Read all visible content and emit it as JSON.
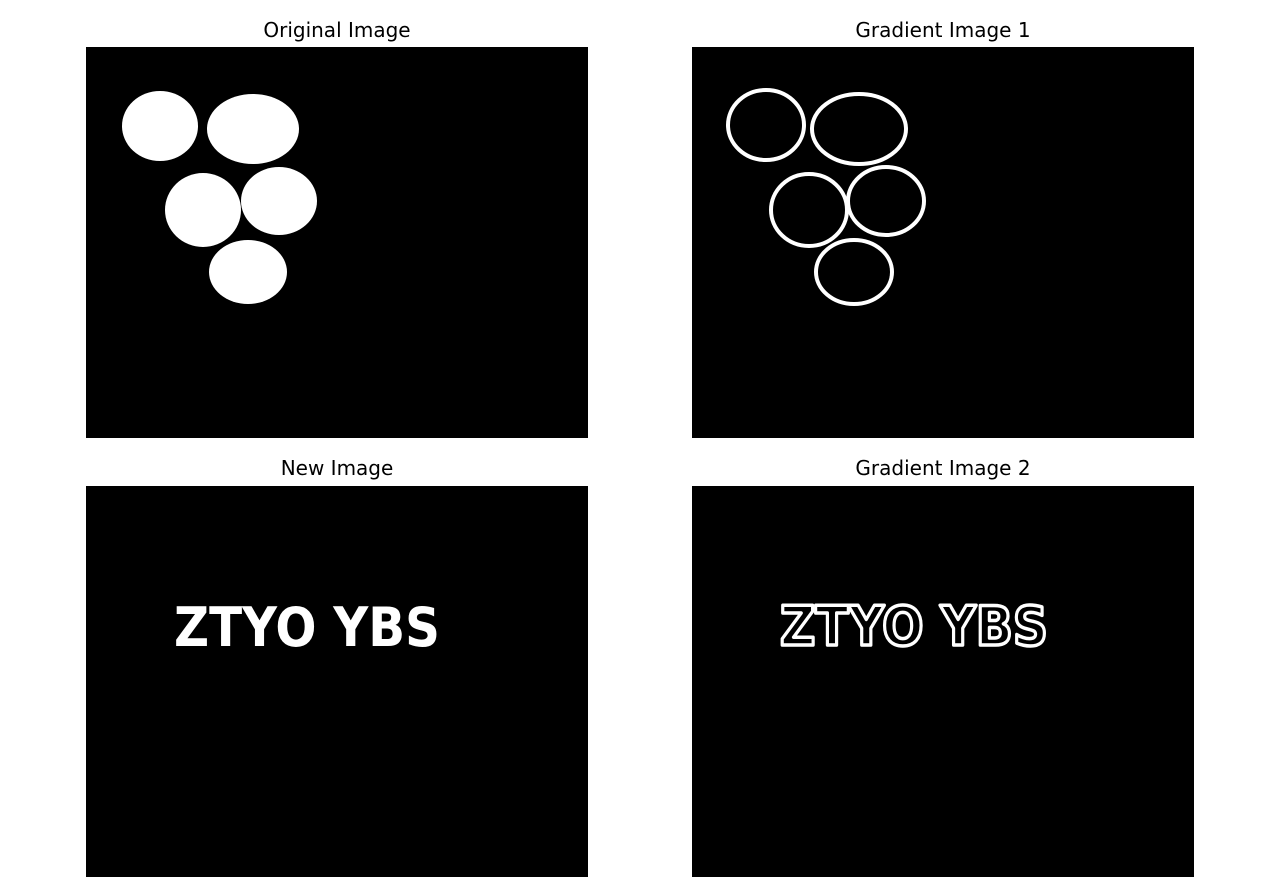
{
  "panels": [
    {
      "title": "Original Image"
    },
    {
      "title": "Gradient Image 1"
    },
    {
      "title": "New Image",
      "image_text": "ZTYO YBS"
    },
    {
      "title": "Gradient Image 2",
      "image_text": "ZTYO YBS"
    }
  ],
  "colors": {
    "background": "#000000",
    "foreground": "#ffffff"
  }
}
